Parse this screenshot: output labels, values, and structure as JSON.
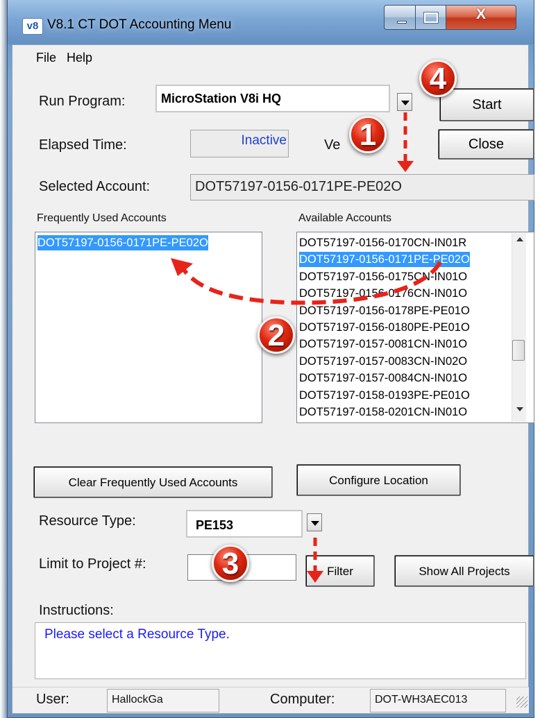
{
  "window": {
    "icon_text": "v8",
    "title": "V8.1 CT DOT Accounting Menu",
    "close_glyph": "X"
  },
  "menu": [
    "File",
    "Help"
  ],
  "run_program": {
    "label": "Run Program:",
    "value": "MicroStation V8i HQ"
  },
  "buttons": {
    "start": "Start",
    "close": "Close",
    "clear_frequent": "Clear Frequently Used Accounts",
    "configure_location": "Configure Location",
    "filter": "Filter",
    "show_all_projects": "Show All Projects"
  },
  "elapsed": {
    "label": "Elapsed Time:",
    "value": "Inactive"
  },
  "version_partial": "Ve",
  "selected_account": {
    "label": "Selected Account:",
    "value": "DOT57197-0156-0171PE-PE02O"
  },
  "frequent_accounts": {
    "label": "Frequently Used Accounts",
    "items": [
      "DOT57197-0156-0171PE-PE02O"
    ],
    "selected_index": 0
  },
  "available_accounts": {
    "label": "Available Accounts",
    "items": [
      "DOT57197-0156-0170CN-IN01R",
      "DOT57197-0156-0171PE-PE02O",
      "DOT57197-0156-0175CN-IN01O",
      "DOT57197-0156-0176CN-IN01O",
      "DOT57197-0156-0178PE-PE01O",
      "DOT57197-0156-0180PE-PE01O",
      "DOT57197-0157-0081CN-IN01O",
      "DOT57197-0157-0083CN-IN02O",
      "DOT57197-0157-0084CN-IN01O",
      "DOT57197-0158-0193PE-PE01O",
      "DOT57197-0158-0201CN-IN01O"
    ],
    "selected_index": 1
  },
  "resource_type": {
    "label": "Resource Type:",
    "value": "PE153"
  },
  "limit_project": {
    "label": "Limit to Project #:",
    "value": ""
  },
  "instructions": {
    "label": "Instructions:",
    "text": "Please select a Resource Type."
  },
  "status": {
    "user_label": "User:",
    "user_value": "HallockGa",
    "computer_label": "Computer:",
    "computer_value": "DOT-WH3AEC013"
  },
  "callouts": [
    "1",
    "2",
    "3",
    "4"
  ],
  "colors": {
    "accent_red": "#e02a13",
    "arrow_red": "#e8231a",
    "selection_blue": "#3399ff",
    "instruction_text": "#1a1aff",
    "inactive_text": "#1c3fd6"
  }
}
